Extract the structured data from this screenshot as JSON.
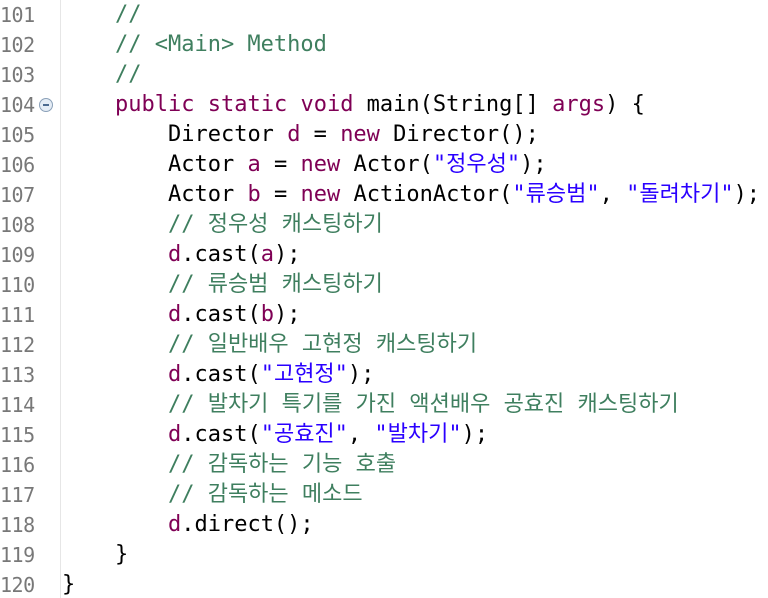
{
  "lines": [
    {
      "no": "101",
      "indent": "    ",
      "tokens": [
        {
          "t": "//",
          "c": "cmt"
        }
      ]
    },
    {
      "no": "102",
      "indent": "    ",
      "tokens": [
        {
          "t": "// <Main> Method",
          "c": "cmt"
        }
      ]
    },
    {
      "no": "103",
      "indent": "    ",
      "tokens": [
        {
          "t": "//",
          "c": "cmt"
        }
      ]
    },
    {
      "no": "104",
      "indent": "    ",
      "fold": true,
      "tokens": [
        {
          "t": "public",
          "c": "kw"
        },
        {
          "t": " "
        },
        {
          "t": "static",
          "c": "kw"
        },
        {
          "t": " "
        },
        {
          "t": "void",
          "c": "kw"
        },
        {
          "t": " main(String[] "
        },
        {
          "t": "args",
          "c": "kw"
        },
        {
          "t": ") {"
        }
      ]
    },
    {
      "no": "105",
      "indent": "        ",
      "tokens": [
        {
          "t": "Director "
        },
        {
          "t": "d",
          "c": "kw"
        },
        {
          "t": " = "
        },
        {
          "t": "new",
          "c": "kw"
        },
        {
          "t": " Director();"
        }
      ]
    },
    {
      "no": "106",
      "indent": "        ",
      "tokens": [
        {
          "t": "Actor "
        },
        {
          "t": "a",
          "c": "kw"
        },
        {
          "t": " = "
        },
        {
          "t": "new",
          "c": "kw"
        },
        {
          "t": " Actor("
        },
        {
          "t": "\"정우성\"",
          "c": "str"
        },
        {
          "t": ");"
        }
      ]
    },
    {
      "no": "107",
      "indent": "        ",
      "tokens": [
        {
          "t": "Actor "
        },
        {
          "t": "b",
          "c": "kw"
        },
        {
          "t": " = "
        },
        {
          "t": "new",
          "c": "kw"
        },
        {
          "t": " ActionActor("
        },
        {
          "t": "\"류승범\"",
          "c": "str"
        },
        {
          "t": ", "
        },
        {
          "t": "\"돌려차기\"",
          "c": "str"
        },
        {
          "t": ");"
        }
      ]
    },
    {
      "no": "108",
      "indent": "        ",
      "tokens": [
        {
          "t": "// 정우성 캐스팅하기",
          "c": "cmt"
        }
      ]
    },
    {
      "no": "109",
      "indent": "        ",
      "tokens": [
        {
          "t": "d",
          "c": "kw"
        },
        {
          "t": ".cast("
        },
        {
          "t": "a",
          "c": "kw"
        },
        {
          "t": ");"
        }
      ]
    },
    {
      "no": "110",
      "indent": "        ",
      "tokens": [
        {
          "t": "// 류승범 캐스팅하기",
          "c": "cmt"
        }
      ]
    },
    {
      "no": "111",
      "indent": "        ",
      "tokens": [
        {
          "t": "d",
          "c": "kw"
        },
        {
          "t": ".cast("
        },
        {
          "t": "b",
          "c": "kw"
        },
        {
          "t": ");"
        }
      ]
    },
    {
      "no": "112",
      "indent": "        ",
      "tokens": [
        {
          "t": "// 일반배우 고현정 캐스팅하기",
          "c": "cmt"
        }
      ]
    },
    {
      "no": "113",
      "indent": "        ",
      "tokens": [
        {
          "t": "d",
          "c": "kw"
        },
        {
          "t": ".cast("
        },
        {
          "t": "\"고현정\"",
          "c": "str"
        },
        {
          "t": ");"
        }
      ]
    },
    {
      "no": "114",
      "indent": "        ",
      "tokens": [
        {
          "t": "// 발차기 특기를 가진 액션배우 공효진 캐스팅하기",
          "c": "cmt"
        }
      ]
    },
    {
      "no": "115",
      "indent": "        ",
      "tokens": [
        {
          "t": "d",
          "c": "kw"
        },
        {
          "t": ".cast("
        },
        {
          "t": "\"공효진\"",
          "c": "str"
        },
        {
          "t": ", "
        },
        {
          "t": "\"발차기\"",
          "c": "str"
        },
        {
          "t": ");"
        }
      ]
    },
    {
      "no": "116",
      "indent": "        ",
      "tokens": [
        {
          "t": "// 감독하는 기능 호출",
          "c": "cmt"
        }
      ]
    },
    {
      "no": "117",
      "indent": "        ",
      "tokens": [
        {
          "t": "// 감독하는 메소드",
          "c": "cmt"
        }
      ]
    },
    {
      "no": "118",
      "indent": "        ",
      "tokens": [
        {
          "t": "d",
          "c": "kw"
        },
        {
          "t": ".direct();"
        }
      ]
    },
    {
      "no": "119",
      "indent": "    ",
      "tokens": [
        {
          "t": "}"
        }
      ]
    },
    {
      "no": "120",
      "indent": "",
      "tokens": [
        {
          "t": "}"
        }
      ]
    }
  ]
}
